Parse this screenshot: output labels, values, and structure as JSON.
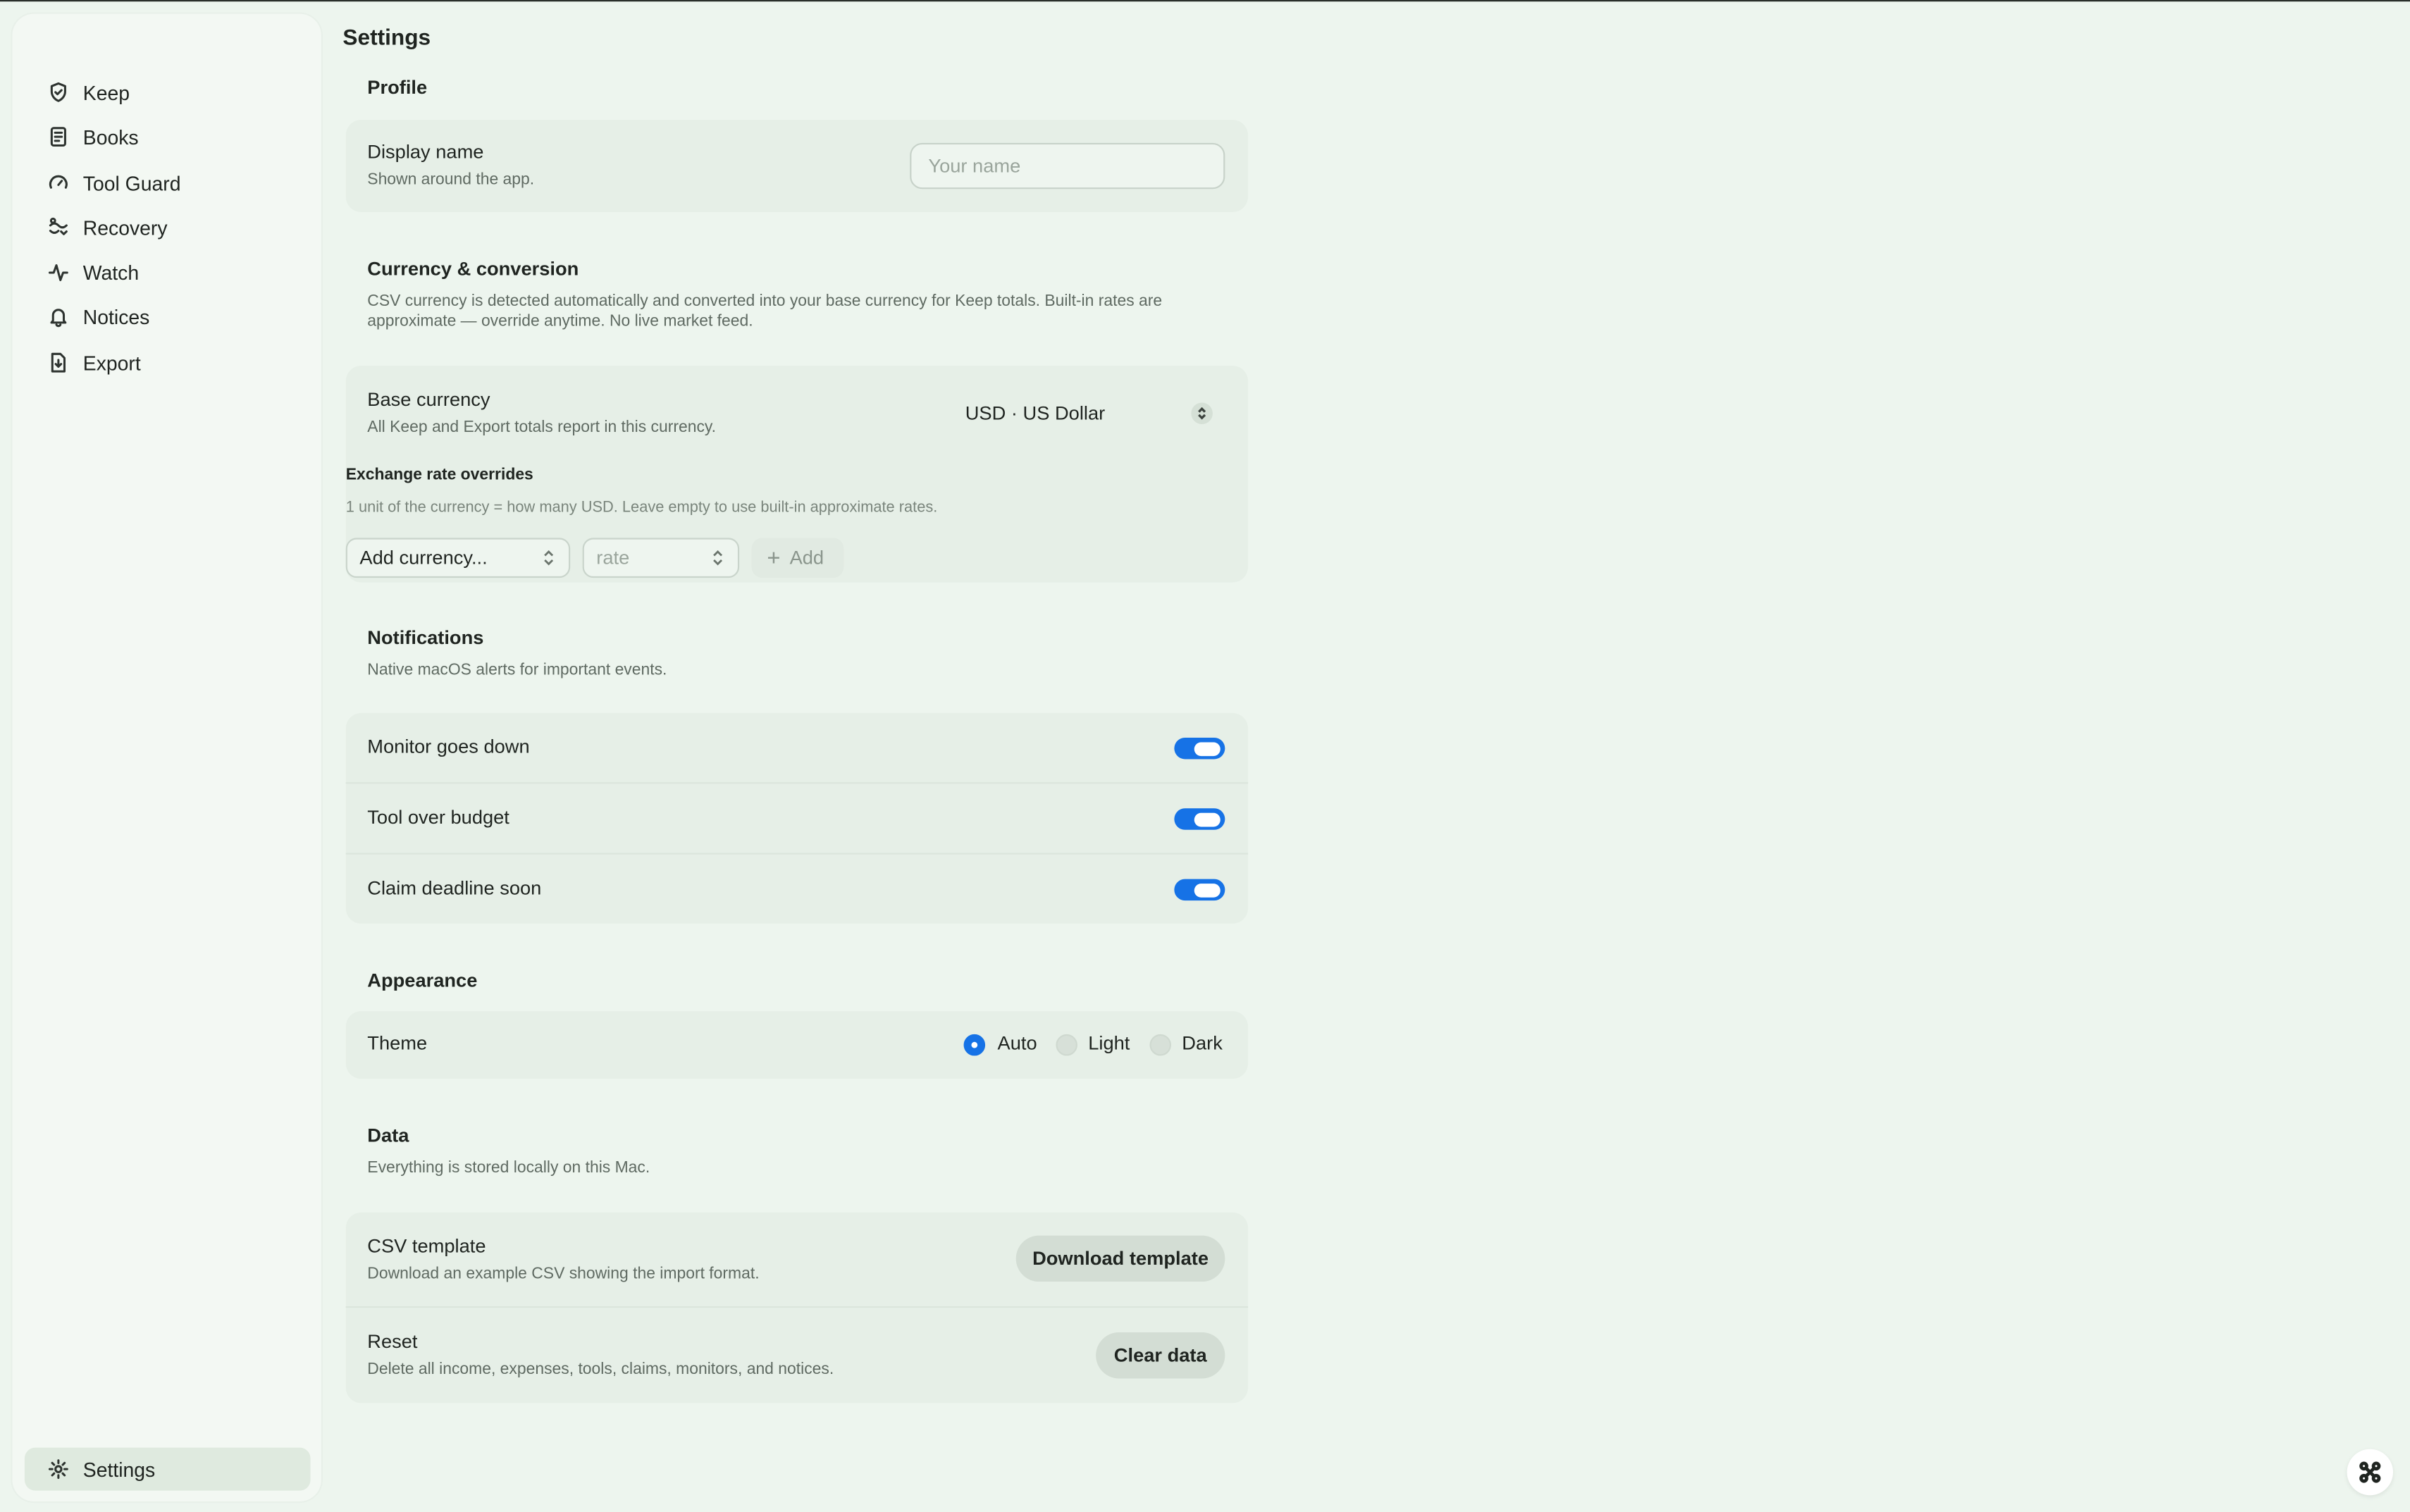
{
  "sidebar": {
    "items": [
      {
        "label": "Keep",
        "icon": "shield-icon"
      },
      {
        "label": "Books",
        "icon": "book-icon"
      },
      {
        "label": "Tool Guard",
        "icon": "gauge-icon"
      },
      {
        "label": "Recovery",
        "icon": "recovery-icon"
      },
      {
        "label": "Watch",
        "icon": "pulse-icon"
      },
      {
        "label": "Notices",
        "icon": "bell-icon"
      },
      {
        "label": "Export",
        "icon": "export-icon"
      }
    ],
    "settings_label": "Settings"
  },
  "page": {
    "title": "Settings"
  },
  "profile": {
    "title": "Profile",
    "display_name_label": "Display name",
    "display_name_sub": "Shown around the app.",
    "display_name_placeholder": "Your name",
    "display_name_value": ""
  },
  "currency": {
    "title": "Currency & conversion",
    "desc_line1": "CSV currency is detected automatically and converted into your base currency for Keep totals. Built-in rates are",
    "desc_line2": "approximate — override anytime. No live market feed.",
    "base_label": "Base currency",
    "base_sub": "All Keep and Export totals report in this currency.",
    "base_value": "USD · US Dollar",
    "overrides_title": "Exchange rate overrides",
    "overrides_help": "1 unit of the currency = how many USD. Leave empty to use built-in approximate rates.",
    "add_currency_label": "Add currency...",
    "rate_placeholder": "rate",
    "add_label": "Add"
  },
  "notifications": {
    "title": "Notifications",
    "desc": "Native macOS alerts for important events.",
    "items": [
      {
        "label": "Monitor goes down",
        "on": true
      },
      {
        "label": "Tool over budget",
        "on": true
      },
      {
        "label": "Claim deadline soon",
        "on": true
      }
    ]
  },
  "appearance": {
    "title": "Appearance",
    "theme_label": "Theme",
    "options": [
      "Auto",
      "Light",
      "Dark"
    ],
    "selected": "Auto"
  },
  "data_section": {
    "title": "Data",
    "desc": "Everything is stored locally on this Mac.",
    "csv_label": "CSV template",
    "csv_sub": "Download an example CSV showing the import format.",
    "csv_button": "Download template",
    "reset_label": "Reset",
    "reset_sub": "Delete all income, expenses, tools, claims, monitors, and notices.",
    "reset_button": "Clear data"
  },
  "colors": {
    "accent": "#1672e6",
    "background": "#edf5ee",
    "card": "#e6efe7"
  }
}
